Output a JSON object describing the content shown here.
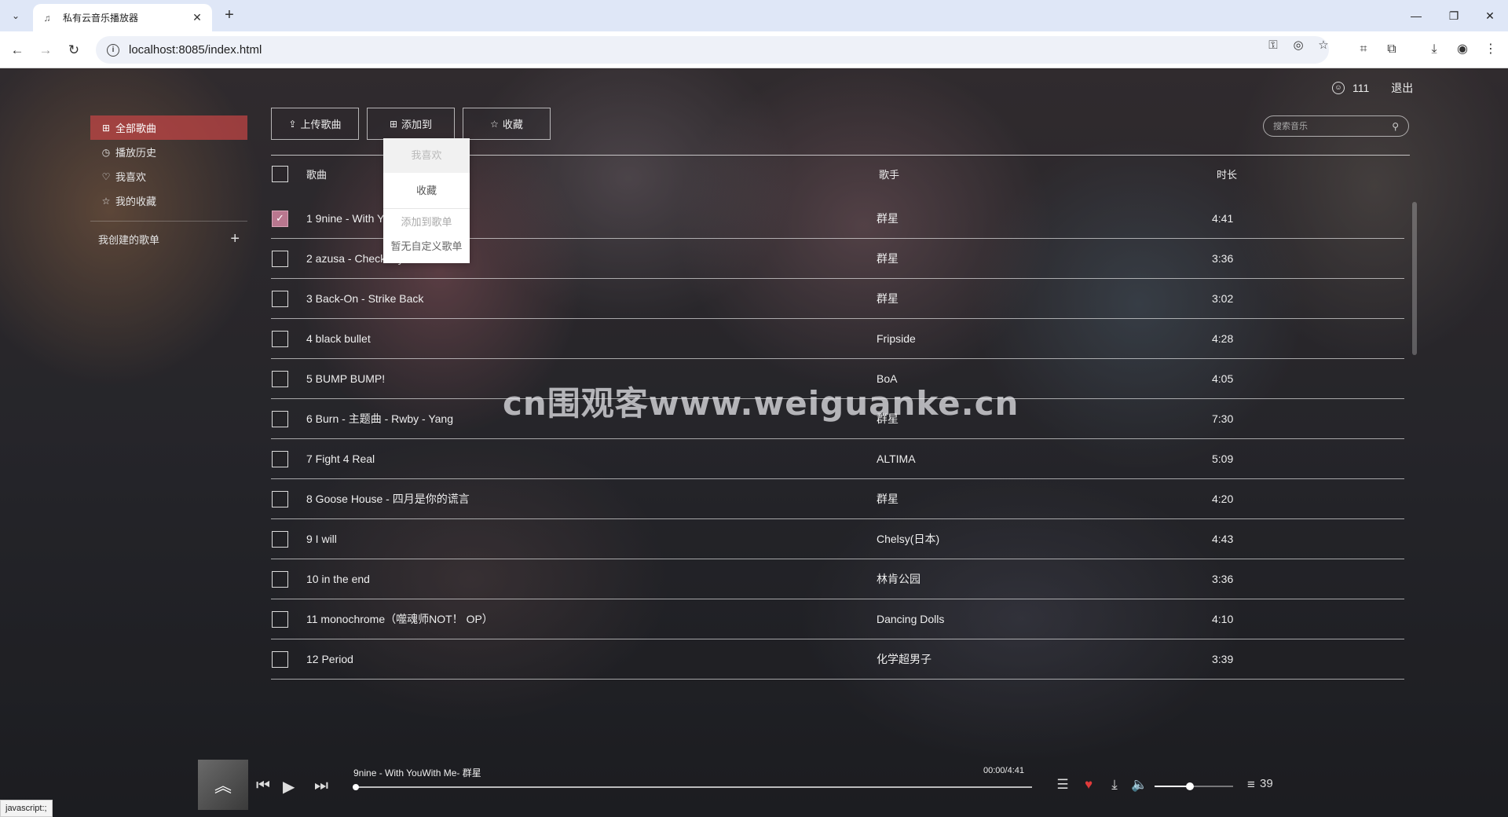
{
  "browser": {
    "tab_title": "私有云音乐播放器",
    "url": "localhost:8085/index.html",
    "status_text": "javascript:;"
  },
  "sidebar": {
    "items": [
      {
        "label": "全部歌曲",
        "icon": "grid-icon",
        "active": true
      },
      {
        "label": "播放历史",
        "icon": "clock-icon",
        "active": false
      },
      {
        "label": "我喜欢",
        "icon": "heart-icon",
        "active": false
      },
      {
        "label": "我的收藏",
        "icon": "star-icon",
        "active": false
      }
    ],
    "playlists_label": "我创建的歌单"
  },
  "user": {
    "name": "111",
    "logout_label": "退出"
  },
  "toolbar": {
    "upload_label": "上传歌曲",
    "add_to_label": "添加到",
    "collect_label": "收藏"
  },
  "search": {
    "placeholder": "搜索音乐"
  },
  "dropdown": {
    "likes_label": "我喜欢",
    "collect_label": "收藏",
    "playlists_header": "添加到歌单",
    "no_playlists": "暂无自定义歌单"
  },
  "table": {
    "headers": {
      "song": "歌曲",
      "artist": "歌手",
      "duration": "时长"
    },
    "rows": [
      {
        "title": "1 9nine - With YouWith Me",
        "artist": "群星",
        "duration": "4:41",
        "checked": true
      },
      {
        "title": "2 azusa - Check my soul",
        "artist": "群星",
        "duration": "3:36",
        "checked": false
      },
      {
        "title": "3 Back-On - Strike Back",
        "artist": "群星",
        "duration": "3:02",
        "checked": false
      },
      {
        "title": "4 black bullet",
        "artist": "Fripside",
        "duration": "4:28",
        "checked": false
      },
      {
        "title": "5 BUMP BUMP!",
        "artist": "BoA",
        "duration": "4:05",
        "checked": false
      },
      {
        "title": "6 Burn - 主题曲 - Rwby - Yang",
        "artist": "群星",
        "duration": "7:30",
        "checked": false
      },
      {
        "title": "7 Fight 4 Real",
        "artist": "ALTIMA",
        "duration": "5:09",
        "checked": false
      },
      {
        "title": "8 Goose House - 四月是你的谎言",
        "artist": "群星",
        "duration": "4:20",
        "checked": false
      },
      {
        "title": "9 I will",
        "artist": "Chelsy(日本)",
        "duration": "4:43",
        "checked": false
      },
      {
        "title": "10 in the end",
        "artist": "林肯公园",
        "duration": "3:36",
        "checked": false
      },
      {
        "title": "11 monochrome（噬魂师NOT！ OP）",
        "artist": "Dancing Dolls",
        "duration": "4:10",
        "checked": false
      },
      {
        "title": "12 Period",
        "artist": "化学超男子",
        "duration": "3:39",
        "checked": false
      }
    ]
  },
  "watermark": "cn围观客www.weiguanke.cn",
  "player": {
    "now_playing": "9nine - With YouWith Me- 群星",
    "time": "00:00/4:41",
    "progress": 0,
    "volume": 0.45,
    "queue_count": "39",
    "liked": true
  },
  "colors": {
    "accent": "#c84646",
    "check": "#b9778f",
    "heart": "#e03a3a"
  }
}
